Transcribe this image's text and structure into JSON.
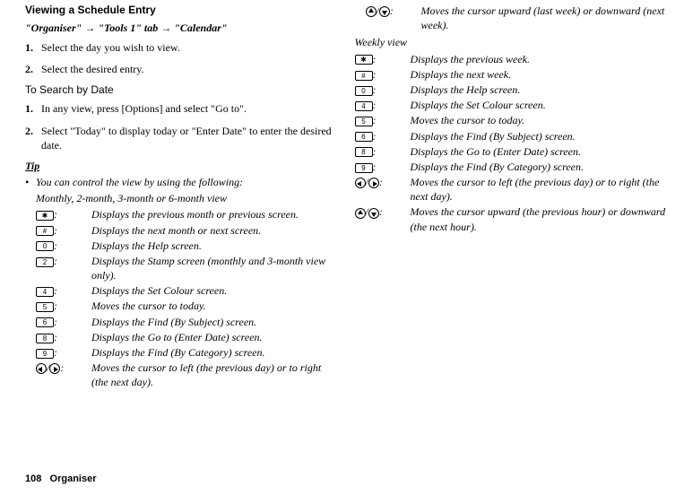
{
  "left": {
    "heading": "Viewing a Schedule Entry",
    "path": {
      "p1": "\"Organiser\"",
      "p2": "\"Tools 1\" tab",
      "p3": "\"Calendar\""
    },
    "steps_view": [
      "Select the day you wish to view.",
      "Select the desired entry."
    ],
    "search_heading": "To Search by Date",
    "steps_search": [
      "In any view, press [Options] and select \"Go to\".",
      "Select \"Today\" to display today or \"Enter Date\" to enter the desired date."
    ],
    "tip_label": "Tip",
    "tip_line": "You can control the view by using the following:",
    "monthly_title": "Monthly, 2-month, 3-month or 6-month view",
    "monthly_rows": [
      {
        "key_type": "label",
        "key_label": "✱",
        "desc": "Displays the previous month or previous screen."
      },
      {
        "key_type": "label",
        "key_label": "#",
        "desc": "Displays the next month or next screen."
      },
      {
        "key_type": "label",
        "key_label": "0",
        "desc": "Displays the Help screen."
      },
      {
        "key_type": "label",
        "key_label": "2",
        "desc": "Displays the Stamp screen (monthly and 3-month view only)."
      },
      {
        "key_type": "label",
        "key_label": "4",
        "desc": "Displays the Set Colour screen."
      },
      {
        "key_type": "label",
        "key_label": "5",
        "desc": "Moves the cursor to today."
      },
      {
        "key_type": "label",
        "key_label": "6",
        "desc": "Displays the Find (By Subject) screen."
      },
      {
        "key_type": "label",
        "key_label": "8",
        "desc": "Displays the Go to (Enter Date) screen."
      },
      {
        "key_type": "label",
        "key_label": "9",
        "desc": "Displays the Find (By Category) screen."
      },
      {
        "key_type": "navpair",
        "dir1": "left",
        "dir2": "right",
        "desc": "Moves the cursor to left (the previous day) or to right (the next day)."
      }
    ]
  },
  "right": {
    "top_rows": [
      {
        "key_type": "navpair",
        "dir1": "up",
        "dir2": "down",
        "desc": "Moves the cursor upward (last week) or downward (next week)."
      }
    ],
    "weekly_title": "Weekly view",
    "weekly_rows": [
      {
        "key_type": "label",
        "key_label": "✱",
        "desc": "Displays the previous week."
      },
      {
        "key_type": "label",
        "key_label": "#",
        "desc": "Displays the next week."
      },
      {
        "key_type": "label",
        "key_label": "0",
        "desc": "Displays the Help screen."
      },
      {
        "key_type": "label",
        "key_label": "4",
        "desc": "Displays the Set Colour screen."
      },
      {
        "key_type": "label",
        "key_label": "5",
        "desc": "Moves the cursor to today."
      },
      {
        "key_type": "label",
        "key_label": "6",
        "desc": "Displays the Find (By Subject) screen."
      },
      {
        "key_type": "label",
        "key_label": "8",
        "desc": "Displays the Go to (Enter Date) screen."
      },
      {
        "key_type": "label",
        "key_label": "9",
        "desc": "Displays the Find (By Category) screen."
      },
      {
        "key_type": "navpair",
        "dir1": "left",
        "dir2": "right",
        "desc": "Moves the cursor to left (the previous day) or to right (the next day)."
      },
      {
        "key_type": "navpair",
        "dir1": "up",
        "dir2": "down",
        "desc": "Moves the cursor upward (the previous hour) or downward (the next hour)."
      }
    ]
  },
  "footer": {
    "page": "108",
    "section": "Organiser"
  }
}
